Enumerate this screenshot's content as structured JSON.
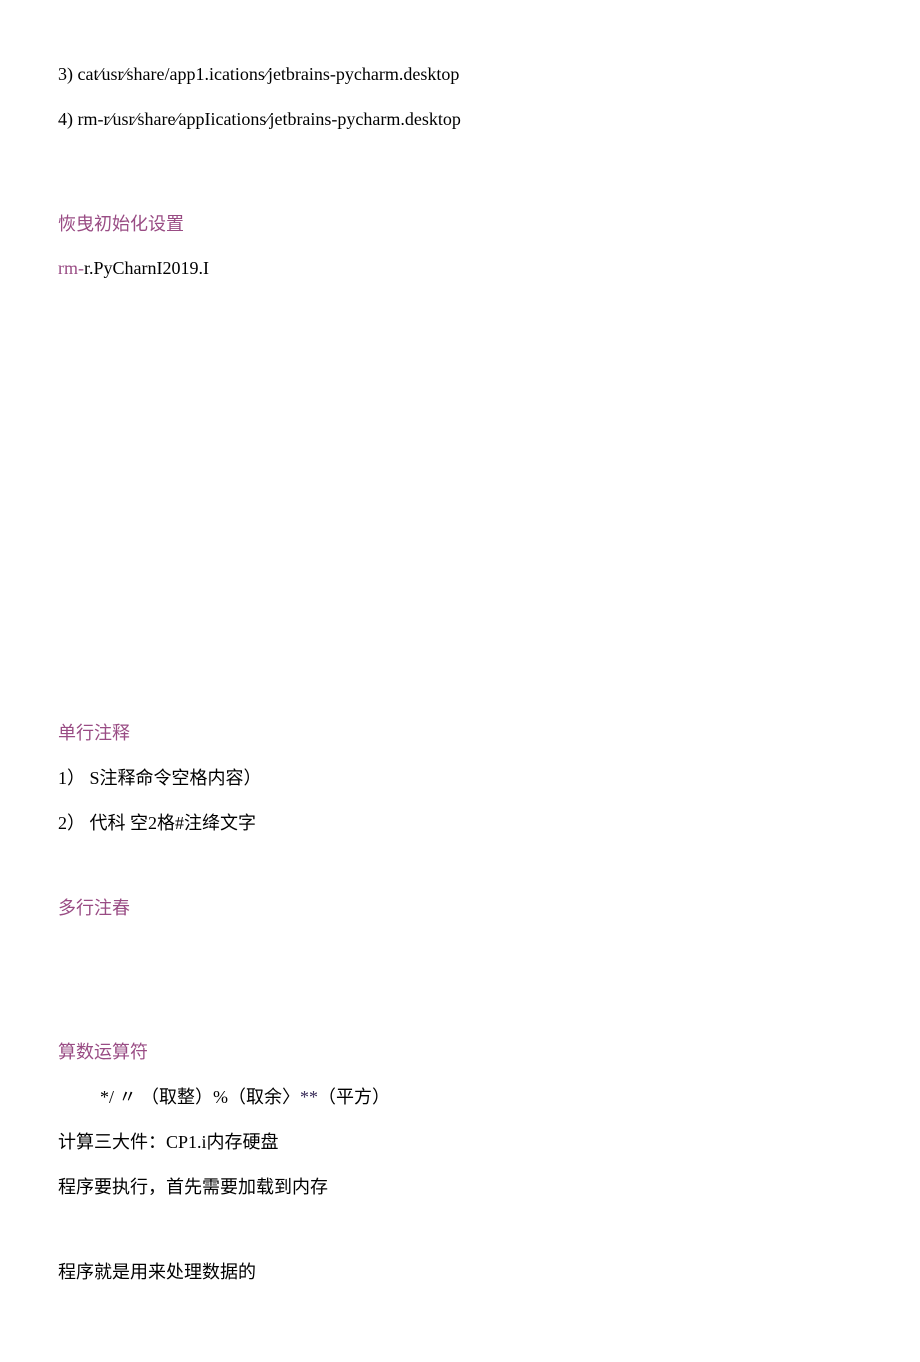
{
  "lines": {
    "cmd3": "3)    cat⁄usr⁄share/app1.ications⁄jetbrains-pycharm.desktop",
    "cmd4": "4)    rm-r⁄usr⁄share⁄appIications⁄jetbrains-pycharm.desktop",
    "reset_heading": "恢曳初始化设置",
    "reset_cmd_prefix": "rm-",
    "reset_cmd_rest": "r.PyCharnI2019.I",
    "single_comment_heading": "单行注释",
    "sc_line1": "1）     S注释命令空格内容）",
    "sc_line2": "2）     代科        空2格#注绛文字",
    "multi_comment_heading": "多行注春",
    "operator_heading": "算数运算符",
    "operator_symbols_prefix": "*/ 〃 （取整）%（取余〉",
    "operator_asterisk": "**",
    "operator_square": "（平方）",
    "calc_parts": "计算三大件：CP1.i内存硬盘",
    "program_exec": "程序要执行，首先需要加载到内存",
    "program_data": "程序就是用来处理数据的"
  }
}
